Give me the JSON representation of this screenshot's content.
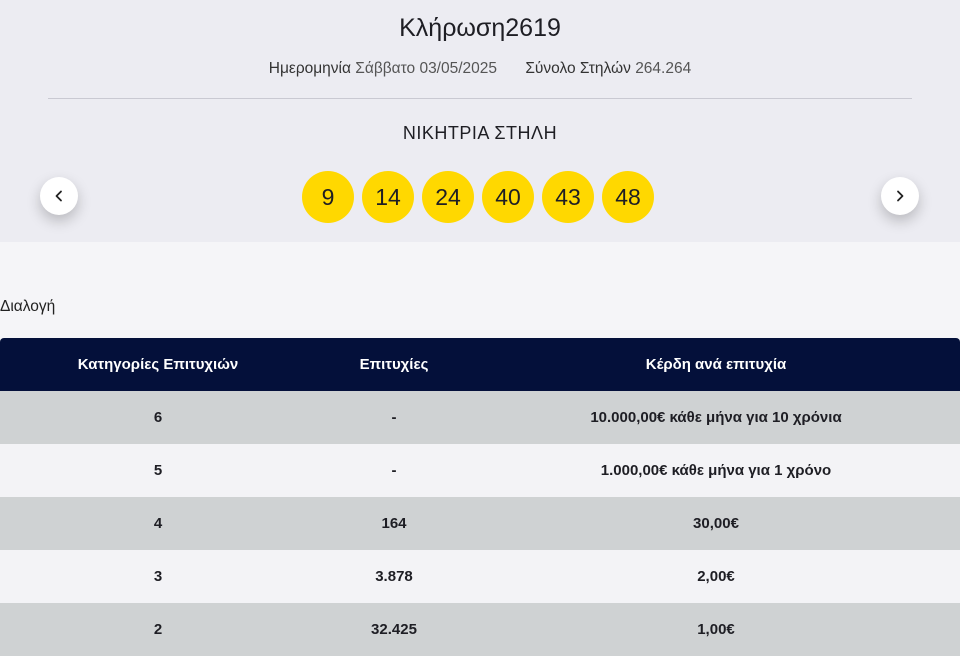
{
  "draw": {
    "title_prefix": "Κλήρωση",
    "number": "2619",
    "date_label": "Ημερομηνία",
    "date_value": "Σάββατο 03/05/2025",
    "total_label": "Σύνολο Στηλών",
    "total_value": "264.264"
  },
  "winning": {
    "label": "ΝΙΚΗΤΡΙΑ ΣΤΗΛΗ",
    "numbers": [
      "9",
      "14",
      "24",
      "40",
      "43",
      "48"
    ],
    "ball_color": "#ffd800"
  },
  "nav": {
    "prev_icon": "chevron-left-icon",
    "next_icon": "chevron-right-icon"
  },
  "sort_label": "Διαλογή",
  "table": {
    "headers": [
      "Κατηγορίες Επιτυχιών",
      "Επιτυχίες",
      "Κέρδη ανά επιτυχία"
    ],
    "header_color": "#04103a",
    "rows": [
      {
        "category": "6",
        "winners": "-",
        "prize": "10.000,00€ κάθε μήνα για 10 χρόνια"
      },
      {
        "category": "5",
        "winners": "-",
        "prize": "1.000,00€ κάθε μήνα για 1 χρόνο"
      },
      {
        "category": "4",
        "winners": "164",
        "prize": "30,00€"
      },
      {
        "category": "3",
        "winners": "3.878",
        "prize": "2,00€"
      },
      {
        "category": "2",
        "winners": "32.425",
        "prize": "1,00€"
      }
    ]
  }
}
